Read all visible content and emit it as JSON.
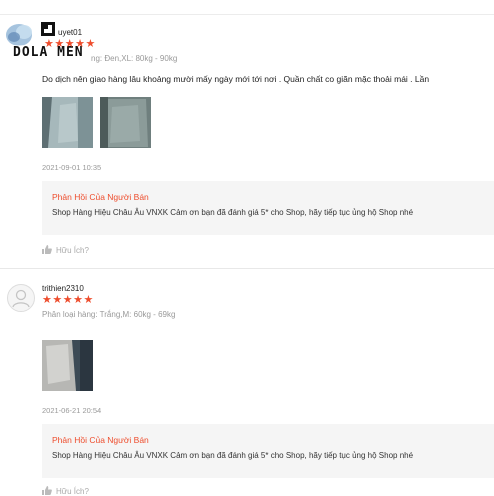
{
  "watermark": {
    "text": "DOLA MEN"
  },
  "reviews": [
    {
      "username": "uyet01",
      "stars": "★★★★★",
      "variation": "ng: Đen,XL: 80kg - 90kg",
      "comment": "Do dịch nên giao hàng lâu khoảng mười mấy ngày mới tới nơi . Quần chất co giãn  mặc thoải mái . Lần",
      "timestamp": "2021-09-01 10:35",
      "reply_title": "Phản Hồi Của Người Bán",
      "reply_text": "Shop Hàng Hiệu Châu Âu VNXK Cảm ơn bạn đã đánh giá 5* cho Shop, hãy tiếp tục ủng hộ Shop nhé",
      "helpful": "Hữu Ích?"
    },
    {
      "username": "trithien2310",
      "stars": "★★★★★",
      "variation": "Phân loại hàng: Trắng,M: 60kg - 69kg",
      "timestamp": "2021-06-21 20:54",
      "reply_title": "Phản Hồi Của Người Bán",
      "reply_text": "Shop Hàng Hiệu Châu Âu VNXK Cảm ơn bạn đã đánh giá 5* cho Shop, hãy tiếp tục ủng hộ Shop nhé",
      "helpful": "Hữu Ích?"
    }
  ],
  "icons": {
    "helpful": "thumbs-up-icon",
    "avatar": "user-avatar-icon",
    "logo": "dola-men-logo-icon"
  },
  "colors": {
    "accent": "#ee4d2d",
    "reply_bg": "#f5f5f5",
    "muted": "#999999"
  }
}
